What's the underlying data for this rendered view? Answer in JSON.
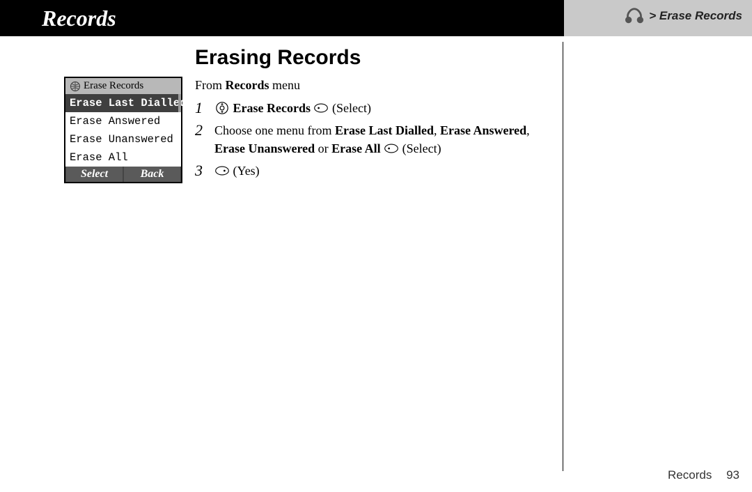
{
  "titlebar": {
    "title": "Records"
  },
  "breadcrumb": {
    "text": "> Erase Records"
  },
  "heading": "Erasing Records",
  "intro": {
    "prefix": "From ",
    "bold": "Records",
    "suffix": " menu"
  },
  "steps": {
    "s1": {
      "num": "1",
      "bold1": "Erase Records",
      "plain1": " (Select)"
    },
    "s2": {
      "num": "2",
      "text_a": "Choose one menu from ",
      "bold_a": "Erase Last Dialled",
      "sep1": ", ",
      "bold_b": "Erase Answered",
      "sep2": ", ",
      "bold_c": "Erase Unanswered",
      "or": " or ",
      "bold_d": "Erase All",
      "tail": " (Select)"
    },
    "s3": {
      "num": "3",
      "tail": " (Yes)"
    }
  },
  "phone": {
    "title": "Erase Records",
    "items": [
      "Erase Last Dialled",
      "Erase Answered",
      "Erase Unanswered",
      "Erase All"
    ],
    "soft_left": "Select",
    "soft_right": "Back"
  },
  "footer": {
    "section": "Records",
    "page": "93"
  }
}
